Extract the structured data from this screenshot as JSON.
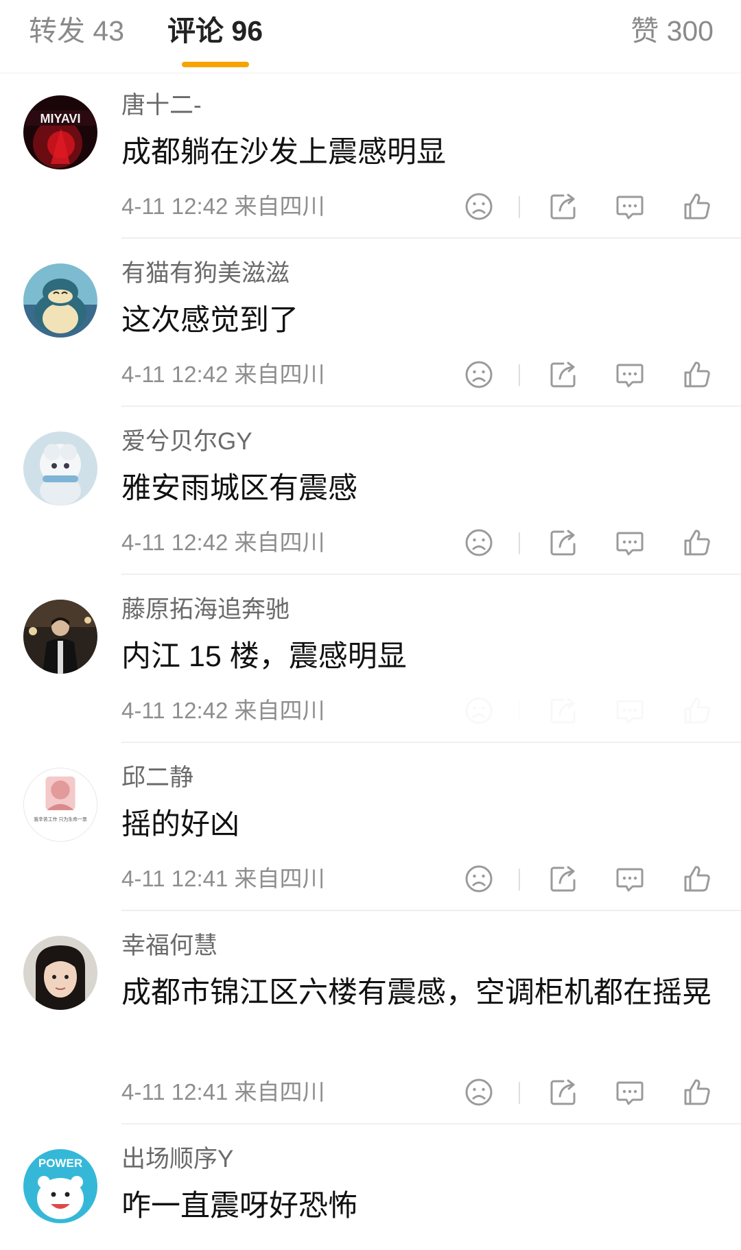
{
  "tabs": {
    "repost": "转发 43",
    "comments": "评论 96",
    "likes": "赞 300"
  },
  "colors": {
    "accent": "#f7a300",
    "username": "#6a6a6a",
    "meta": "#8e8e8e",
    "icon": "#9a9a9a"
  },
  "comments": [
    {
      "username": "唐十二-",
      "text": "成都躺在沙发上震感明显",
      "meta": "4-11 12:42 来自四川",
      "avatar_text": "MIYAVI"
    },
    {
      "username": "有猫有狗美滋滋",
      "text": "这次感觉到了",
      "meta": "4-11 12:42 来自四川"
    },
    {
      "username": "爱兮贝尔GY",
      "text": "雅安雨城区有震感",
      "meta": "4-11 12:42 来自四川"
    },
    {
      "username": "藤原拓海追奔驰",
      "text": "内江 15 楼，震感明显",
      "meta": "4-11 12:42 来自四川"
    },
    {
      "username": "邱二静",
      "text": "摇的好凶",
      "meta": "4-11 12:41 来自四川",
      "avatar_text": "我辛苦工作 只为生命一票"
    },
    {
      "username": "幸福何慧",
      "text": "成都市锦江区六楼有震感，空调柜机都在摇晃",
      "meta": "4-11 12:41 来自四川"
    },
    {
      "username": "出场顺序Y",
      "text": "咋一直震呀好恐怖",
      "avatar_text": "POWER"
    }
  ],
  "icons": {
    "dislike": "sad-face-icon",
    "share": "share-icon",
    "reply": "comment-bubble-icon",
    "like": "thumbs-up-icon"
  }
}
